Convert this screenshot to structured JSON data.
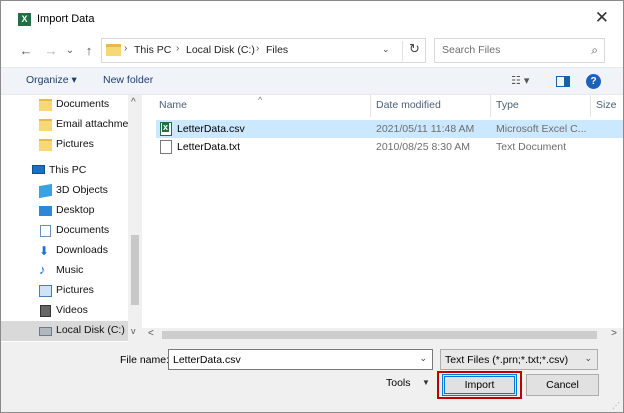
{
  "window": {
    "title": "Import Data",
    "app_icon_letter": "X",
    "close_glyph": "✕"
  },
  "nav_buttons": {
    "back": "←",
    "forward": "→",
    "recent": "⌄",
    "up": "↑"
  },
  "address": {
    "breadcrumb": [
      "This PC",
      "Local Disk (C:)",
      "Files"
    ],
    "separator": "›",
    "dropdown_glyph": "⌄",
    "refresh_glyph": "↻"
  },
  "search": {
    "placeholder": "Search Files",
    "icon": "search-icon"
  },
  "toolbar": {
    "organize": "Organize ▾",
    "new_folder": "New folder",
    "view_glyph": "☷ ▾",
    "help_glyph": "?"
  },
  "sidebar": {
    "items": [
      {
        "label": "Documents",
        "icon": "folder-icon"
      },
      {
        "label": "Email attachmen",
        "icon": "folder-icon"
      },
      {
        "label": "Pictures",
        "icon": "folder-icon"
      },
      {
        "label": "This PC",
        "icon": "computer-icon"
      },
      {
        "label": "3D Objects",
        "icon": "cube-icon"
      },
      {
        "label": "Desktop",
        "icon": "desktop-icon"
      },
      {
        "label": "Documents",
        "icon": "document-icon"
      },
      {
        "label": "Downloads",
        "icon": "download-icon"
      },
      {
        "label": "Music",
        "icon": "music-icon"
      },
      {
        "label": "Pictures",
        "icon": "pictures-icon"
      },
      {
        "label": "Videos",
        "icon": "videos-icon"
      },
      {
        "label": "Local Disk (C:)",
        "icon": "disk-icon",
        "selected": true
      }
    ],
    "scroll_up": "^",
    "scroll_down": "v"
  },
  "file_list": {
    "columns": [
      "Name",
      "Date modified",
      "Type",
      "Size"
    ],
    "sort_indicator": "^",
    "rows": [
      {
        "name": "LetterData.csv",
        "date": "2021/05/11 11:48 AM",
        "type": "Microsoft Excel C...",
        "icon": "excel-csv-icon",
        "selected": true
      },
      {
        "name": "LetterData.txt",
        "date": "2010/08/25 8:30 AM",
        "type": "Text Document",
        "icon": "text-file-icon",
        "selected": false
      }
    ],
    "scroll_left": "<",
    "scroll_right": ">"
  },
  "footer": {
    "file_name_label": "File name:",
    "file_name_value": "LetterData.csv",
    "file_type_value": "Text Files (*.prn;*.txt;*.csv)",
    "dropdown_glyph": "⌄",
    "tools_label": "Tools",
    "tools_caret": "▼",
    "import_label": "Import",
    "cancel_label": "Cancel",
    "grip_glyph": "⋰"
  },
  "colors": {
    "selection": "#cce8ff",
    "nav_selected": "#d9d9d9",
    "highlight_border": "#c00000",
    "default_button_border": "#0078d7",
    "excel_green": "#1e7145"
  }
}
